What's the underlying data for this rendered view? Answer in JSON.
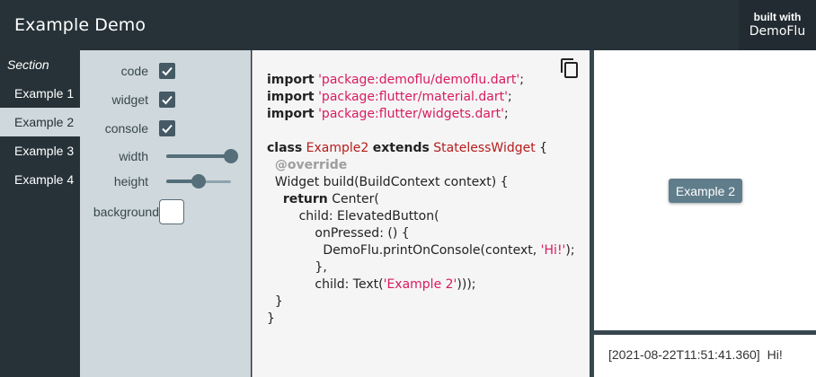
{
  "header": {
    "title": "Example Demo",
    "brand_line1": "built with",
    "brand_line2": "DemoFlu"
  },
  "nav": {
    "heading": "Section",
    "items": [
      {
        "label": "Example 1",
        "selected": false
      },
      {
        "label": "Example 2",
        "selected": true
      },
      {
        "label": "Example 3",
        "selected": false
      },
      {
        "label": "Example 4",
        "selected": false
      }
    ]
  },
  "options": {
    "code": {
      "label": "code",
      "checked": true
    },
    "widget": {
      "label": "widget",
      "checked": true
    },
    "console": {
      "label": "console",
      "checked": true
    },
    "width": {
      "label": "width",
      "value": 1.0
    },
    "height": {
      "label": "height",
      "value": 0.5
    },
    "background": {
      "label": "background",
      "color": "#ffffff"
    }
  },
  "code": {
    "copy_icon": "copy-icon",
    "lines": {
      "l1_kw": "import",
      "l1_str": "'package:demoflu/demoflu.dart'",
      "l1_end": ";",
      "l2_kw": "import",
      "l2_str": "'package:flutter/material.dart'",
      "l2_end": ";",
      "l3_kw": "import",
      "l3_str": "'package:flutter/widgets.dart'",
      "l3_end": ";",
      "l5_kw1": "class",
      "l5_cls1": "Example2",
      "l5_kw2": "extends",
      "l5_cls2": "StatelessWidget",
      "l5_end": " {",
      "l6_ann": "@override",
      "l7": "Widget build(BuildContext context) {",
      "l8_kw": "return",
      "l8_rest": " Center(",
      "l9": "child: ElevatedButton(",
      "l10": "onPressed: () {",
      "l11_a": "DemoFlu.printOnConsole(context, ",
      "l11_str": "'Hi!'",
      "l11_b": ");",
      "l12": "},",
      "l13_a": "child: Text(",
      "l13_str": "'Example 2'",
      "l13_b": ")));",
      "l14": "}",
      "l15": "}"
    }
  },
  "preview": {
    "button_label": "Example 2"
  },
  "console": {
    "timestamp": "[2021-08-22T11:51:41.360]",
    "message": "Hi!"
  },
  "colors": {
    "header_bg": "#263238",
    "panel_bg": "#cfd8dc",
    "accent": "#546e7a",
    "string": "#d81b60",
    "class": "#b71c1c"
  }
}
